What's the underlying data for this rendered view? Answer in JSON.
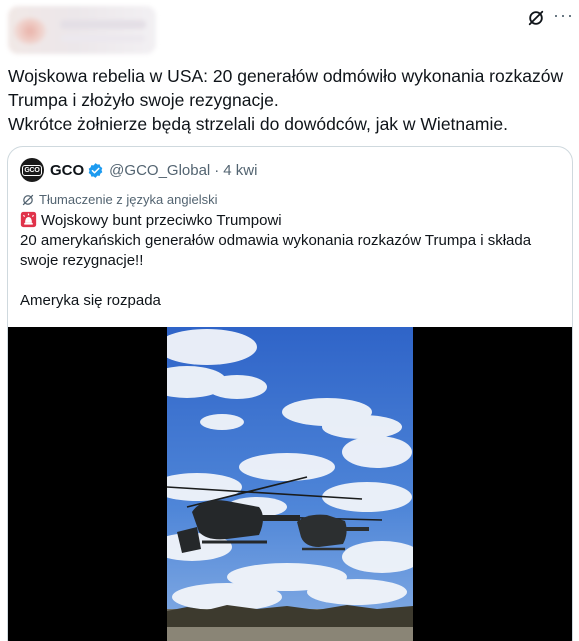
{
  "tweet": {
    "text": "Wojskowa rebelia w USA: 20 generałów odmówiło wykonania rozkazów Trumpa i złożyło swoje rezygnacje.\nWkrótce żołnierze będą strzelali do dowódców, jak w Wietnamie."
  },
  "header": {
    "grok_icon": "grok-slash-icon",
    "more_icon": "more-horizontal-icon",
    "more_label": "···"
  },
  "quote": {
    "logo_text": "GCO",
    "display_name": "GCO",
    "handle": "@GCO_Global",
    "separator": "·",
    "time": "4 kwi",
    "translated_label": "Tłumaczenie z języka angielski",
    "body": "Wojskowy bunt przeciwko Trumpowi\n20 amerykańskich generałów odmawia wykonania rozkazów Trumpa i składa swoje rezygnacje!!\n\nAmeryka się rozpada",
    "verified_color": "#1d9bf0",
    "media": {
      "type": "video",
      "icon": "helicopter-video-thumbnail"
    }
  },
  "colors": {
    "text_primary": "#0f1419",
    "text_secondary": "#536471",
    "border": "#cfd9de",
    "accent": "#1d9bf0"
  }
}
